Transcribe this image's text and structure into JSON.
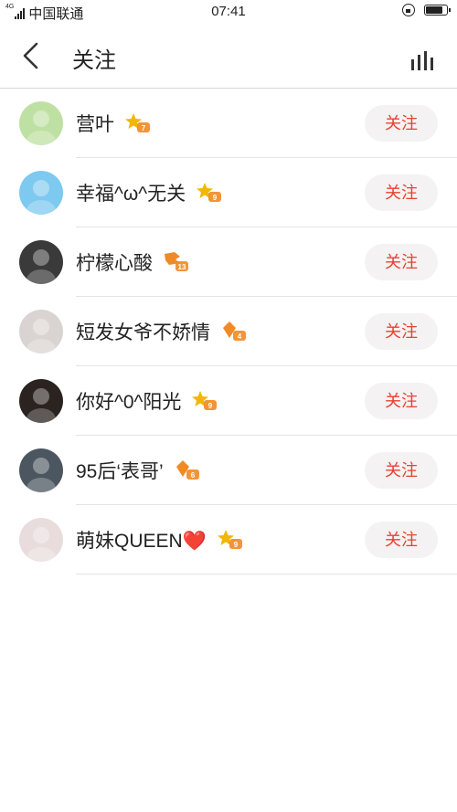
{
  "status_bar": {
    "network_label": "4G",
    "carrier": "中国联通",
    "time": "07:41"
  },
  "header": {
    "title": "关注",
    "back_icon": "chevron-left-icon",
    "right_icon": "bar-chart-icon"
  },
  "colors": {
    "accent": "#e8412f",
    "button_bg": "#f4f2f2",
    "badge_gold": "#f2b705",
    "badge_orange": "#f08a24",
    "divider": "#e4e4e4"
  },
  "users": [
    {
      "name": "营叶",
      "level": "7",
      "badge_icon": "star-level-badge-icon",
      "follow_label": "关注",
      "avatar_color": "#bfe0a3"
    },
    {
      "name": "幸福^ω^无关",
      "level": "9",
      "badge_icon": "star-level-badge-icon",
      "follow_label": "关注",
      "avatar_color": "#7ec9ef"
    },
    {
      "name": "柠檬心酸",
      "level": "13",
      "badge_icon": "flag-level-badge-icon",
      "follow_label": "关注",
      "avatar_color": "#3a3a3a"
    },
    {
      "name": "短发女爷不娇情",
      "level": "4",
      "badge_icon": "diamond-level-badge-icon",
      "follow_label": "关注",
      "avatar_color": "#d9d4d2"
    },
    {
      "name": "你好^0^阳光",
      "level": "9",
      "badge_icon": "star-level-badge-icon",
      "follow_label": "关注",
      "avatar_color": "#2a2320"
    },
    {
      "name": "95后‘表哥’",
      "level": "6",
      "badge_icon": "diamond-level-badge-icon",
      "follow_label": "关注",
      "avatar_color": "#4b5660"
    },
    {
      "name": "萌妹QUEEN❤️",
      "level": "9",
      "badge_icon": "star-level-badge-icon",
      "follow_label": "关注",
      "avatar_color": "#e9dcdc"
    }
  ]
}
